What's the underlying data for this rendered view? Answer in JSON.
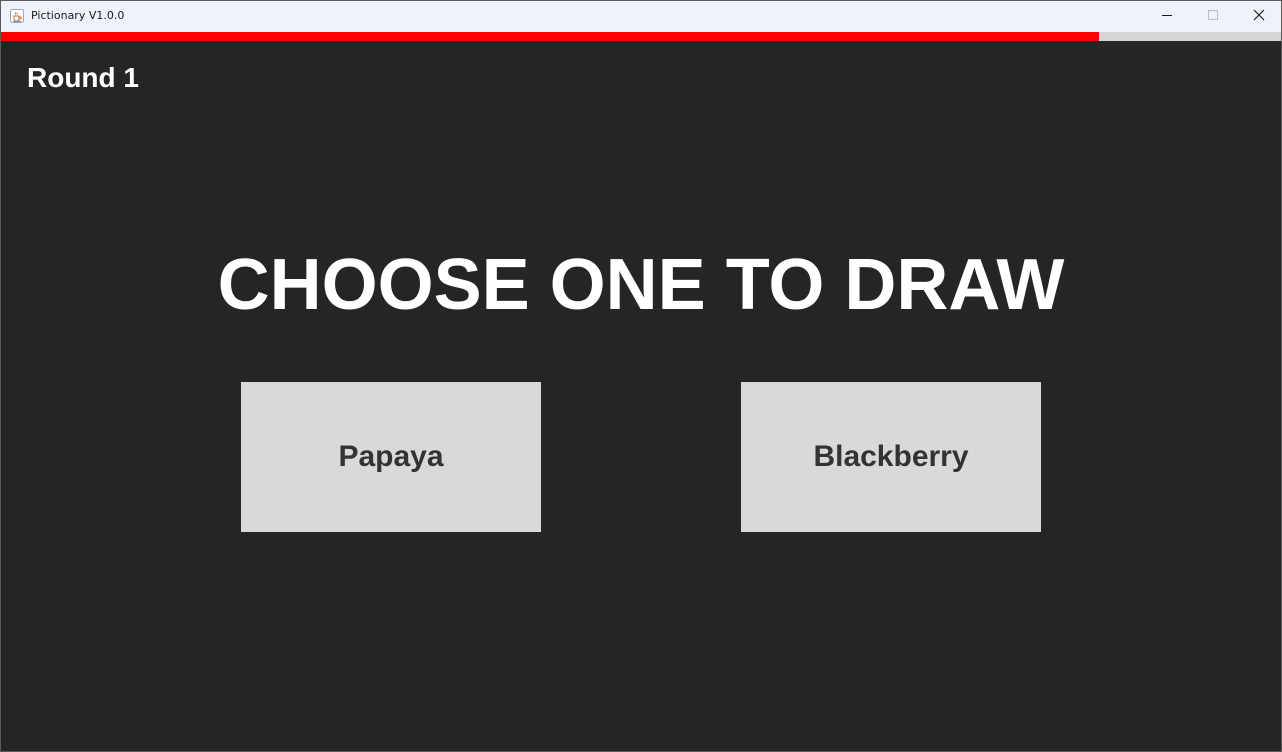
{
  "window": {
    "title": "Pictionary V1.0.0",
    "icons": {
      "app": "java-coffee-cup-icon",
      "minimize": "minimize-icon",
      "maximize": "maximize-icon",
      "close": "close-icon"
    }
  },
  "timer": {
    "remaining_fraction": 0.858,
    "fill_color": "#ff0000",
    "track_color": "#d6d6d6"
  },
  "game": {
    "round_label": "Round 1",
    "headline": "CHOOSE ONE TO DRAW",
    "choices": [
      {
        "label": "Papaya"
      },
      {
        "label": "Blackberry"
      }
    ]
  },
  "colors": {
    "background": "#252525",
    "text": "#ffffff",
    "button_bg": "#d9d9d9",
    "button_text": "#333333"
  }
}
